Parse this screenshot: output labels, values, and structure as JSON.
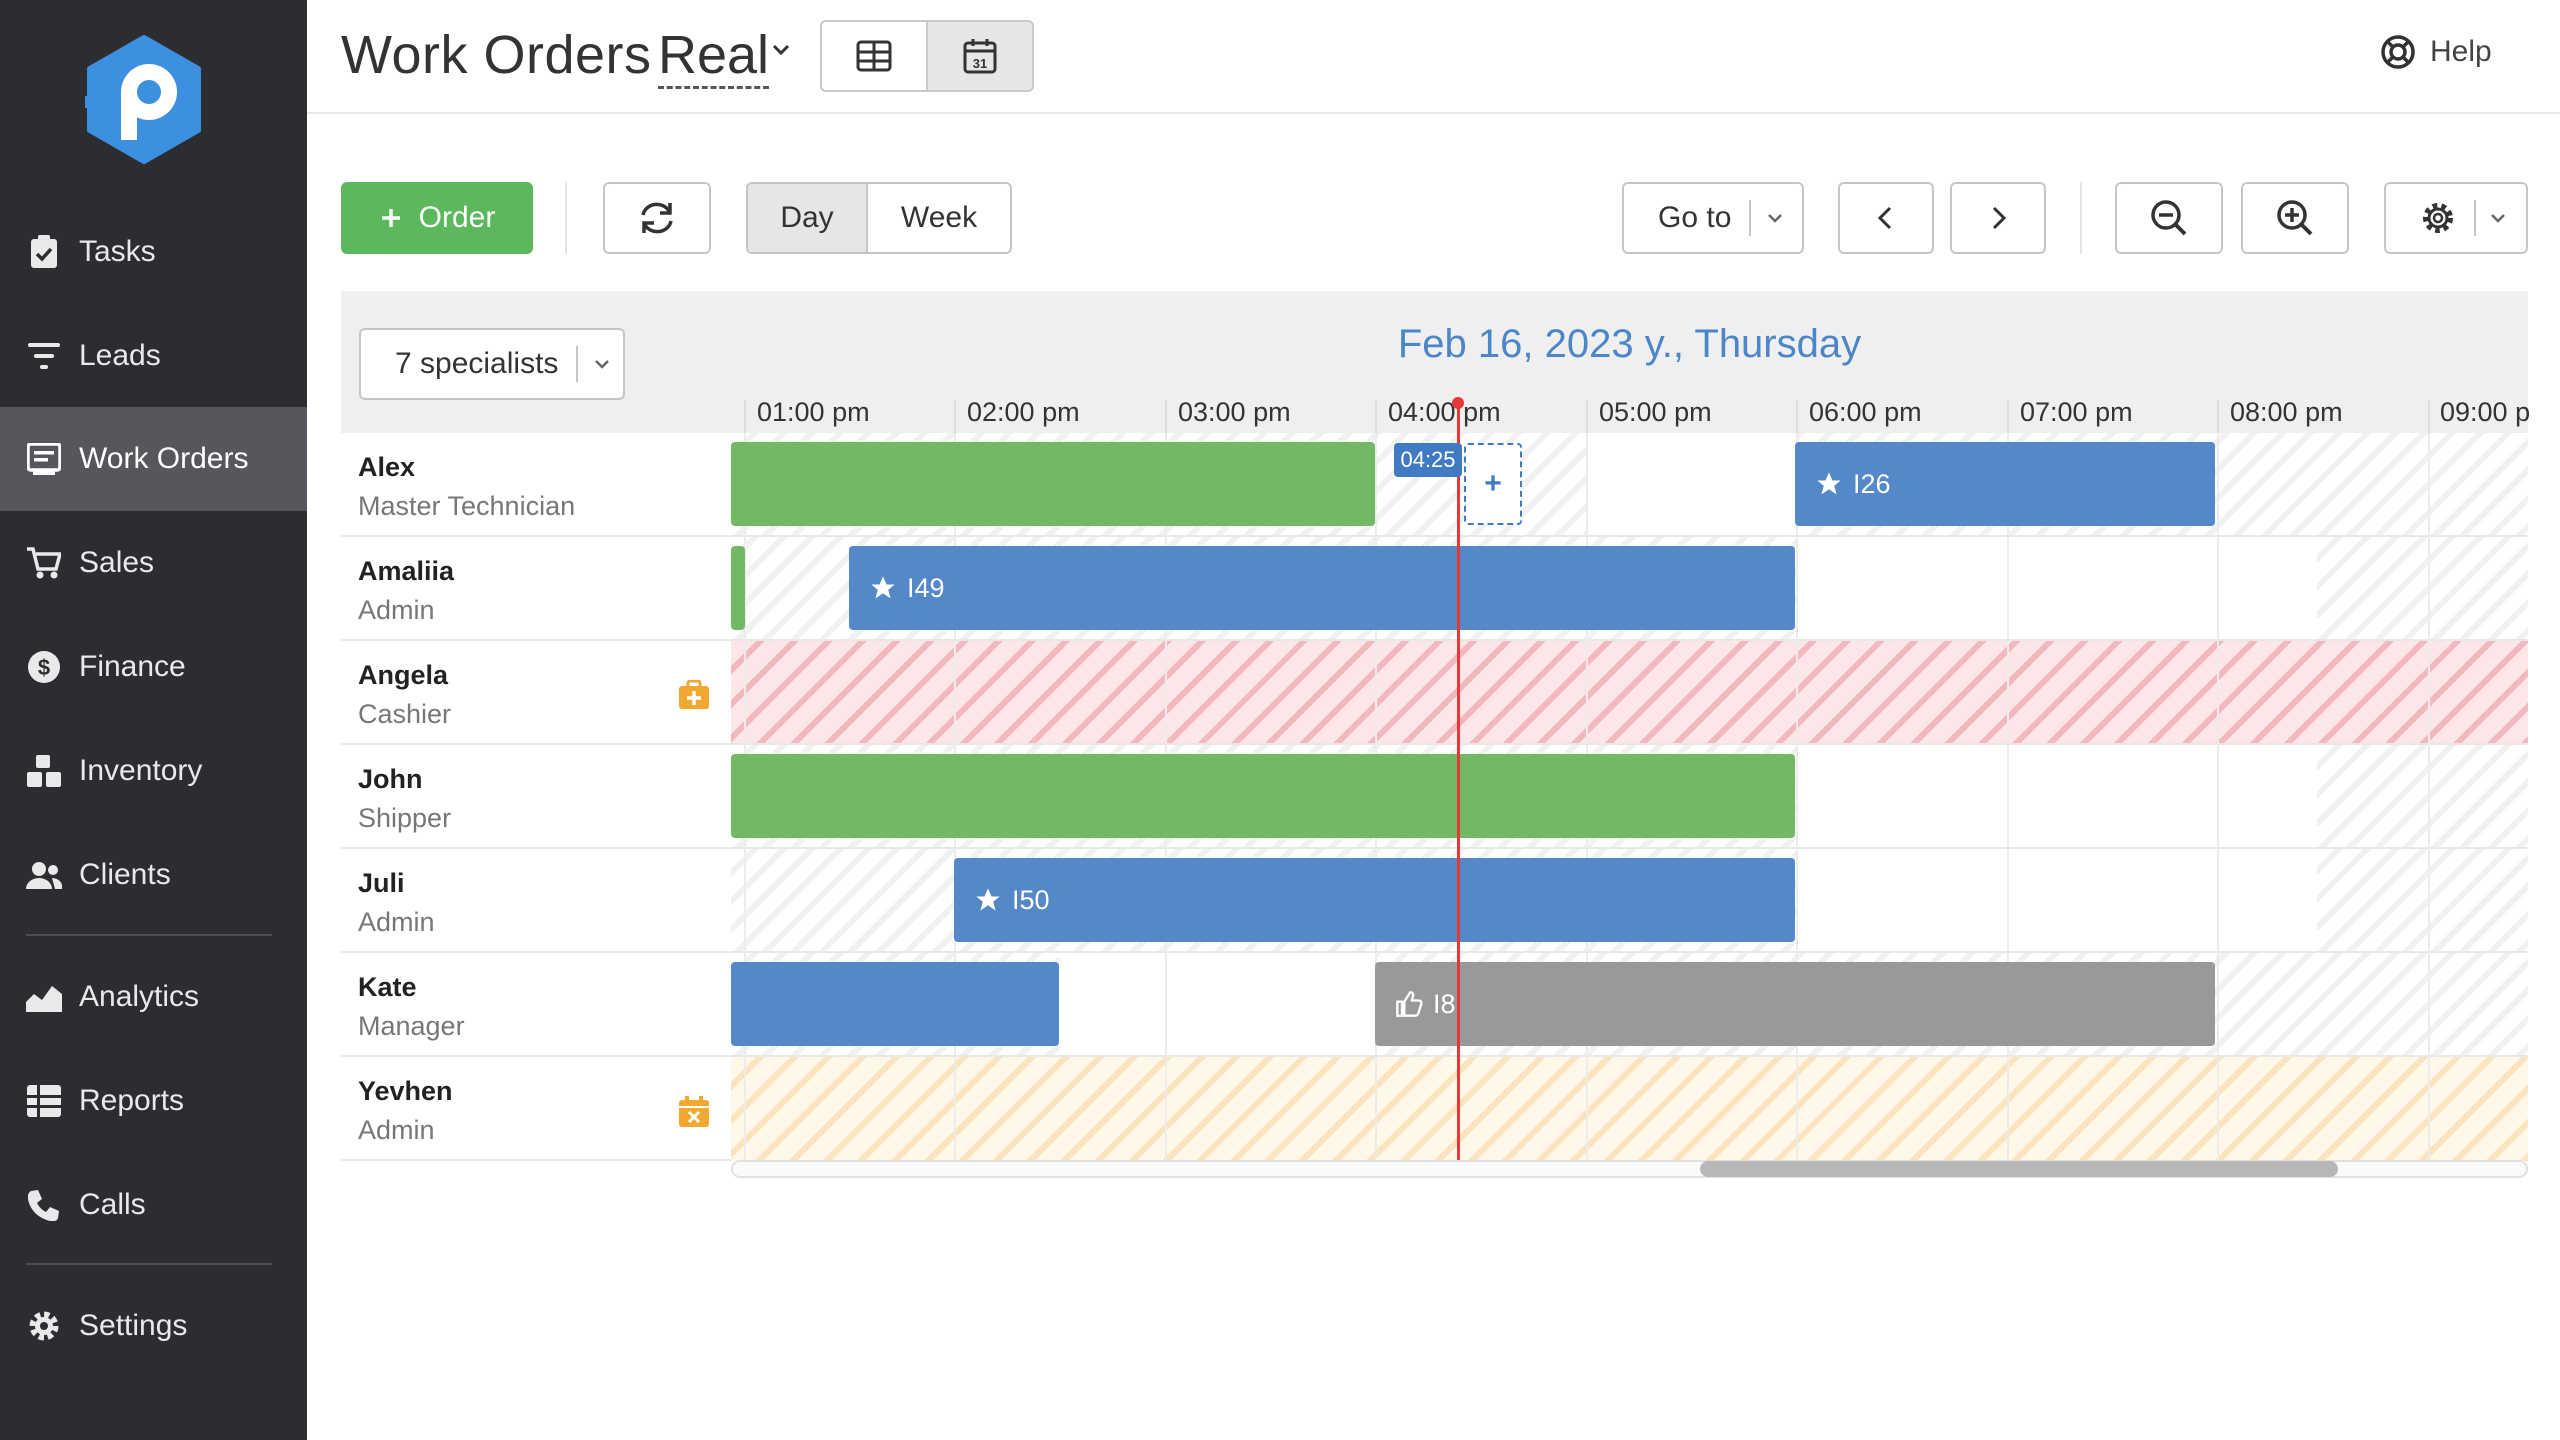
{
  "sidebar": {
    "items": [
      {
        "label": "Tasks",
        "icon": "clipboard-check-icon"
      },
      {
        "label": "Leads",
        "icon": "funnel-icon"
      },
      {
        "label": "Work Orders",
        "icon": "work-orders-icon",
        "active": true
      },
      {
        "label": "Sales",
        "icon": "cart-icon"
      },
      {
        "label": "Finance",
        "icon": "dollar-icon"
      },
      {
        "label": "Inventory",
        "icon": "boxes-icon"
      },
      {
        "label": "Clients",
        "icon": "people-icon"
      },
      {
        "label": "Analytics",
        "icon": "chart-area-icon"
      },
      {
        "label": "Reports",
        "icon": "list-icon"
      },
      {
        "label": "Calls",
        "icon": "phone-icon"
      },
      {
        "label": "Settings",
        "icon": "gear-icon"
      }
    ]
  },
  "header": {
    "title": "Work Orders",
    "view_select": "Real",
    "help_label": "Help"
  },
  "toolbar": {
    "order_label": "Order",
    "day_label": "Day",
    "week_label": "Week",
    "goto_label": "Go to"
  },
  "scheduler": {
    "specialists_label": "7 specialists",
    "date_title": "Feb 16, 2023 y., Thursday",
    "time_labels": [
      "01:00 pm",
      "02:00 pm",
      "03:00 pm",
      "04:00 pm",
      "05:00 pm",
      "06:00 pm",
      "07:00 pm",
      "08:00 pm",
      "09:00 p"
    ],
    "now_time": "04:25",
    "add_slot_symbol": "+",
    "rows": [
      {
        "name": "Alex",
        "role": "Master Technician"
      },
      {
        "name": "Amaliia",
        "role": "Admin"
      },
      {
        "name": "Angela",
        "role": "Cashier",
        "status_icon": "medical-bag-icon"
      },
      {
        "name": "John",
        "role": "Shipper"
      },
      {
        "name": "Juli",
        "role": "Admin"
      },
      {
        "name": "Kate",
        "role": "Manager"
      },
      {
        "name": "Yevhen",
        "role": "Admin",
        "status_icon": "calendar-x-icon"
      }
    ],
    "orders": {
      "i26": "I26",
      "i49": "I49",
      "i50": "I50",
      "i8": "I8"
    }
  },
  "colors": {
    "sidebar_bg": "#2b2d31",
    "primary_green": "#5cb85c",
    "order_blue": "#5588c8",
    "now_red": "#e53935",
    "date_blue": "#4a86c8"
  }
}
